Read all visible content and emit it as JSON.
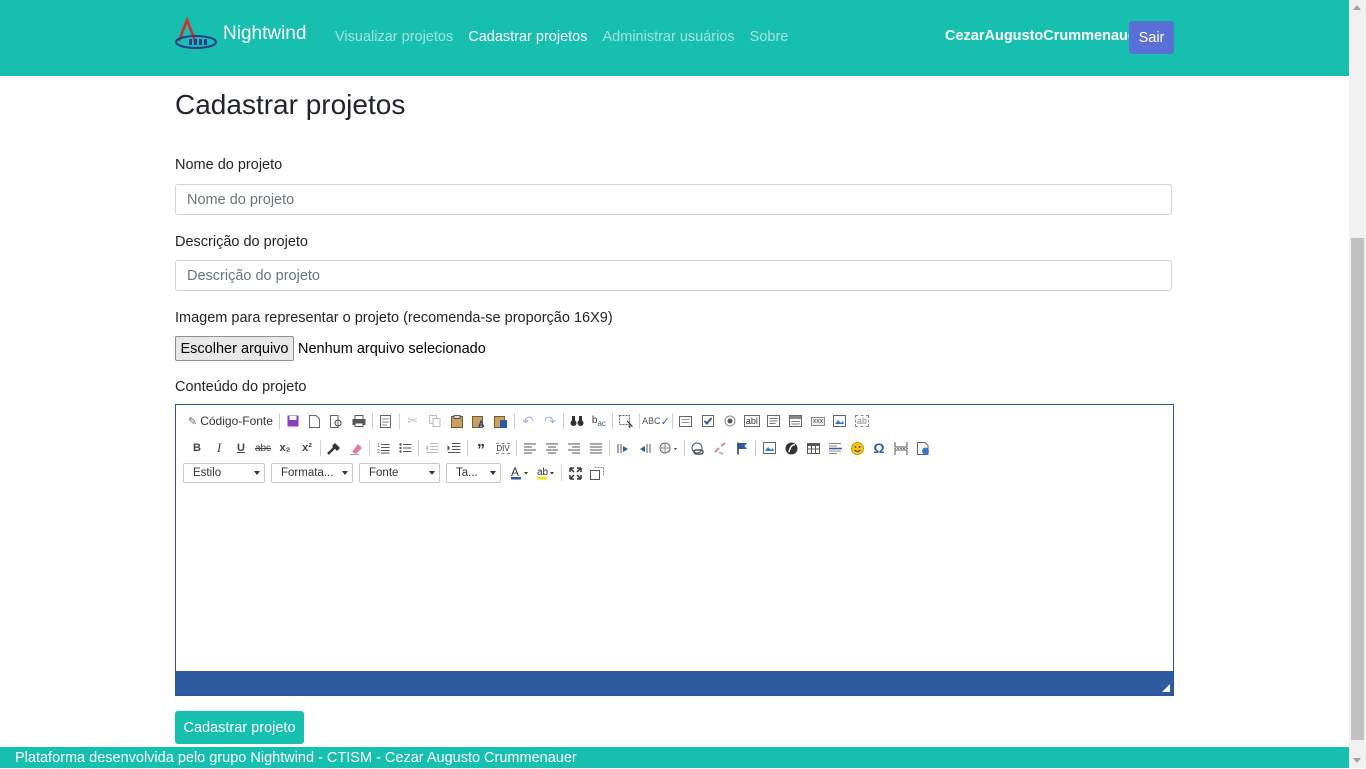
{
  "brand": {
    "name": "Nightwind"
  },
  "nav": [
    {
      "label": "Visualizar projetos",
      "active": false
    },
    {
      "label": "Cadastrar projetos",
      "active": true
    },
    {
      "label": "Administrar usuários",
      "active": false
    },
    {
      "label": "Sobre",
      "active": false
    }
  ],
  "user": {
    "name": "CezarAugustoCrummenauer",
    "logout_label": "Sair"
  },
  "page": {
    "title": "Cadastrar projetos"
  },
  "form": {
    "name_label": "Nome do projeto",
    "name_placeholder": "Nome do projeto",
    "name_value": "",
    "desc_label": "Descrição do projeto",
    "desc_placeholder": "Descrição do projeto",
    "desc_value": "",
    "image_label": "Imagem para representar o projeto (recomenda-se proporção 16X9)",
    "file_button": "Escolher arquivo",
    "file_status": "Nenhum arquivo selecionado",
    "content_label": "Conteúdo do projeto",
    "submit_label": "Cadastrar projeto"
  },
  "editor": {
    "source_label": "Código-Fonte",
    "combos": [
      "Estilo",
      "Formata...",
      "Fonte",
      "Ta..."
    ],
    "bold": "B",
    "italic": "I",
    "underline": "U",
    "strike": "abc",
    "subscript": "x₂",
    "superscript": "x²",
    "omega": "Ω"
  },
  "colors": {
    "primary": "#17bfaf",
    "logout_button": "#5a6fd6",
    "editor_statusbar": "#2e5ba0"
  },
  "footer": {
    "text": "Plataforma desenvolvida pelo grupo Nightwind - CTISM - Cezar Augusto Crummenauer"
  }
}
